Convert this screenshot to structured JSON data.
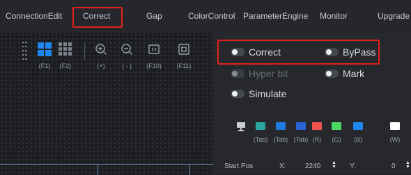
{
  "menu": {
    "items": [
      "ConnectionEdit",
      "Correct",
      "Gap",
      "ColorControl",
      "ParameterEngine",
      "Monitor",
      "Upgrade"
    ],
    "active": "Correct"
  },
  "toolbar": {
    "f1_label": "(F1)",
    "f2_label": "(F2)",
    "zoom_in_label": "(+)",
    "zoom_out_label": "( - )",
    "f10_label": "(F10)",
    "f11_label": "(F11)"
  },
  "options": {
    "correct": "Correct",
    "bypass": "ByPass",
    "hyper_bit": "Hyper bit",
    "mark": "Mark",
    "simulate": "Simulate"
  },
  "color_buttons": [
    {
      "label": "",
      "color": "#c9ccd2"
    },
    {
      "label": "(Tab)",
      "color": "#2aa6a0"
    },
    {
      "label": "(Tab)",
      "color": "#1e7be0"
    },
    {
      "label": "(Tab)",
      "color": "#2a63d6"
    },
    {
      "label": "(R)",
      "color": "#ef5350"
    },
    {
      "label": "(G)",
      "color": "#4cd964"
    },
    {
      "label": "(B)",
      "color": "#1e88f0"
    },
    {
      "label": "(W)",
      "color": "#ffffff"
    }
  ],
  "start_pos": {
    "label": "Start Pos",
    "x_label": "X:",
    "x_value": "2240",
    "y_label": "Y:",
    "y_value": "0"
  },
  "colors": {
    "highlight": "#e0241b",
    "accent_blue": "#1e88f0"
  }
}
